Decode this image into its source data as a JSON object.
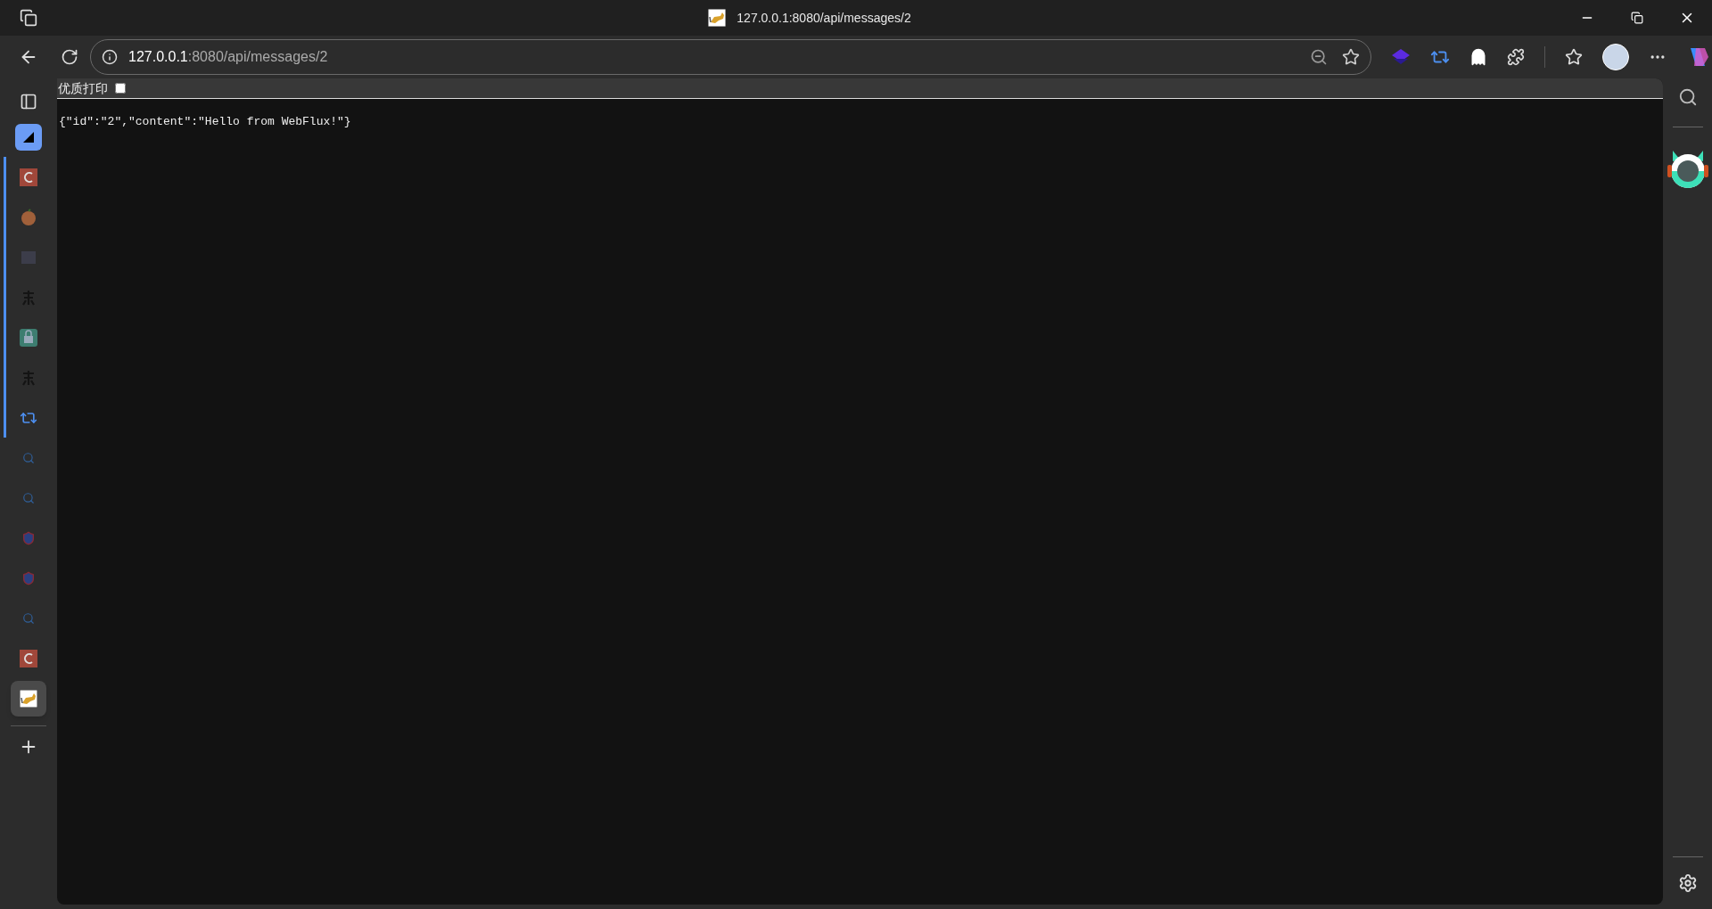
{
  "window": {
    "title": "127.0.0.1:8080/api/messages/2"
  },
  "address_bar": {
    "host": "127.0.0.1",
    "rest": ":8080/api/messages/2"
  },
  "vertical_tabs": [
    {
      "kind": "c-square",
      "selected": false,
      "in_group": true
    },
    {
      "kind": "peach",
      "selected": false,
      "in_group": true
    },
    {
      "kind": "faint-grid",
      "selected": false,
      "in_group": true
    },
    {
      "kind": "faint-glyph",
      "selected": false,
      "in_group": true
    },
    {
      "kind": "news-lock",
      "selected": false,
      "in_group": true
    },
    {
      "kind": "faint-glyph",
      "selected": false,
      "in_group": true
    },
    {
      "kind": "repeat",
      "selected": false,
      "in_group": true
    },
    {
      "kind": "search",
      "selected": false,
      "in_group": false
    },
    {
      "kind": "search",
      "selected": false,
      "in_group": false
    },
    {
      "kind": "shield",
      "selected": false,
      "in_group": false
    },
    {
      "kind": "shield",
      "selected": false,
      "in_group": false
    },
    {
      "kind": "search",
      "selected": false,
      "in_group": false
    },
    {
      "kind": "c-square",
      "selected": false,
      "in_group": false
    },
    {
      "kind": "cat",
      "selected": true,
      "in_group": false
    }
  ],
  "page": {
    "print_option": {
      "label": "优质打印",
      "checked": false
    },
    "body": "{\"id\":\"2\",\"content\":\"Hello from WebFlux!\"}"
  }
}
